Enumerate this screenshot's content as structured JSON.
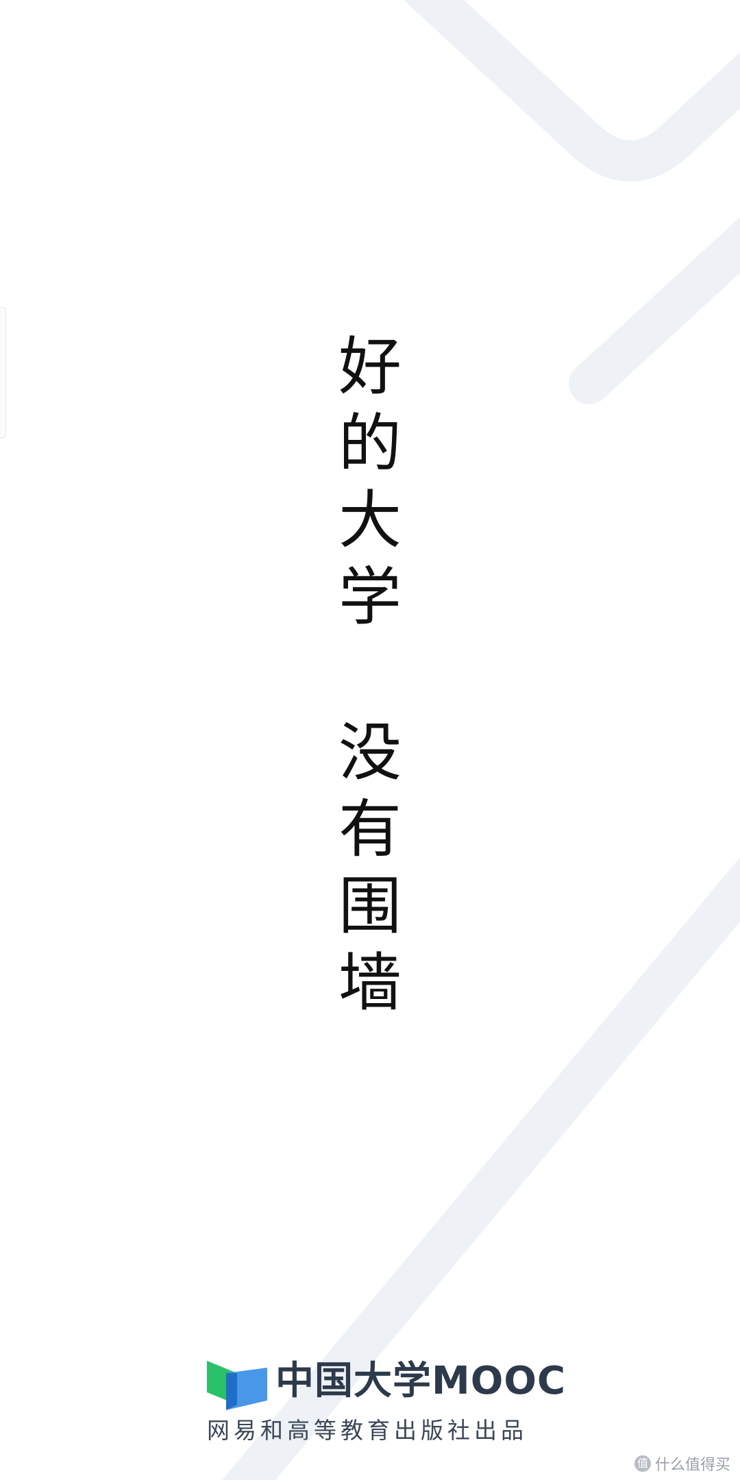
{
  "slogan": {
    "line1": [
      "好",
      "的",
      "大",
      "学"
    ],
    "line2": [
      "没",
      "有",
      "围",
      "墙"
    ]
  },
  "brand": {
    "name": "中国大学MOOC",
    "subtitle": "网易和高等教育出版社出品",
    "logo_icon": "open-book-logo-icon",
    "colors": {
      "green": "#2bc06a",
      "blue": "#3a8ee6",
      "text": "#2d3a4b"
    }
  },
  "watermark": {
    "text": "什么值得买",
    "icon": "smzdm-logo-icon"
  }
}
